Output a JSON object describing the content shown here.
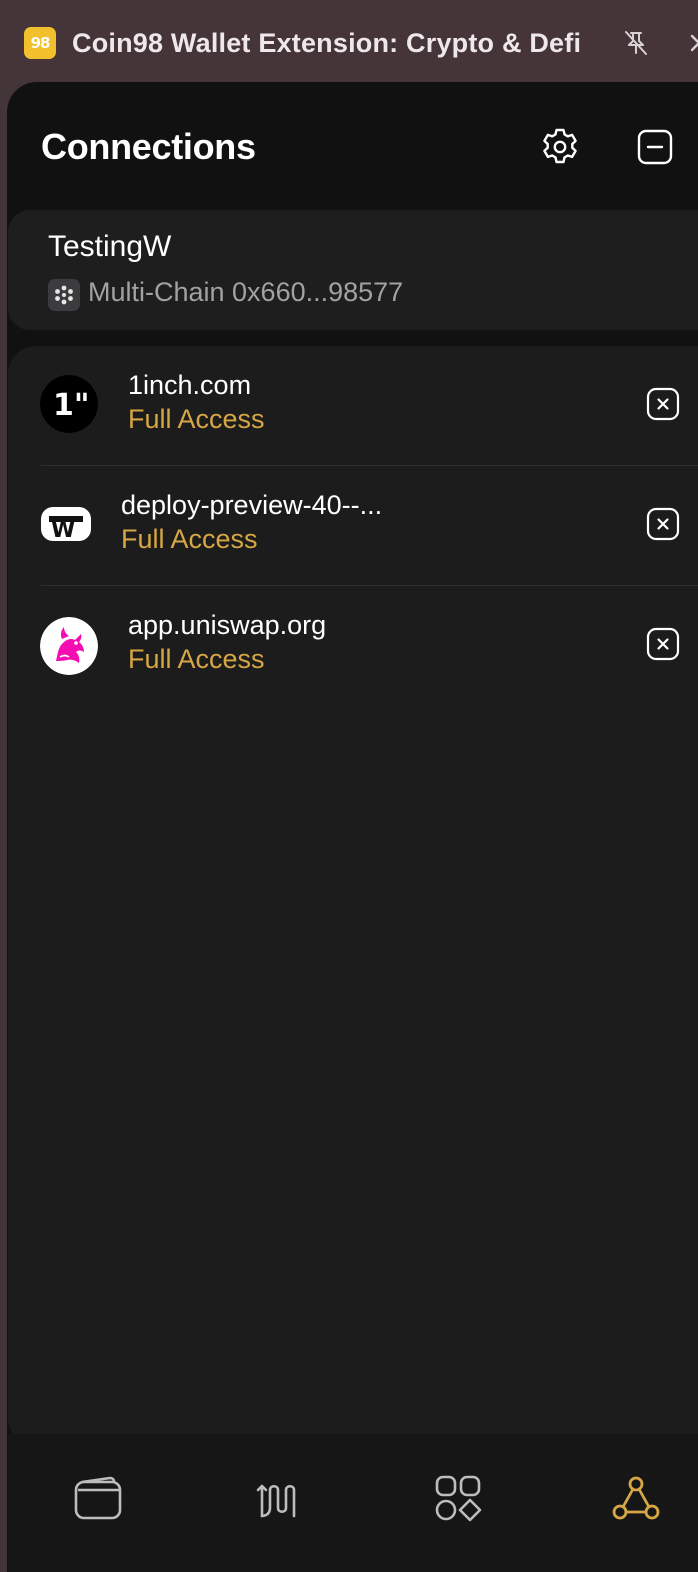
{
  "window": {
    "app_icon_text": "98",
    "title": "Coin98 Wallet Extension: Crypto & Defi",
    "pin_icon": "pin-off-icon",
    "close_icon": "close-icon"
  },
  "header": {
    "title": "Connections",
    "settings_icon": "gear-icon",
    "minimize_icon": "minus-square-icon"
  },
  "wallet": {
    "name": "TestingW",
    "address": "Multi-Chain 0x660...98577",
    "chain_icon": "multi-chain-icon"
  },
  "connections": [
    {
      "site": "1inch.com",
      "access": "Full Access",
      "logo_text": "1\"",
      "logo": "1inch-logo"
    },
    {
      "site": "deploy-preview-40--...",
      "access": "Full Access",
      "logo_text": "W",
      "logo": "w-logo"
    },
    {
      "site": "app.uniswap.org",
      "access": "Full Access",
      "logo": "uniswap-unicorn-logo"
    }
  ],
  "bottom_nav": [
    {
      "name": "wallet",
      "icon": "wallet-icon",
      "active": false
    },
    {
      "name": "swap",
      "icon": "swap-route-icon",
      "active": false
    },
    {
      "name": "apps",
      "icon": "apps-grid-icon",
      "active": false
    },
    {
      "name": "connections",
      "icon": "connections-network-icon",
      "active": true
    }
  ],
  "colors": {
    "background": "#111112",
    "card": "#1e1e1f",
    "accent": "#d6a744",
    "text": "#ffffff",
    "muted": "#a2a2a4"
  }
}
